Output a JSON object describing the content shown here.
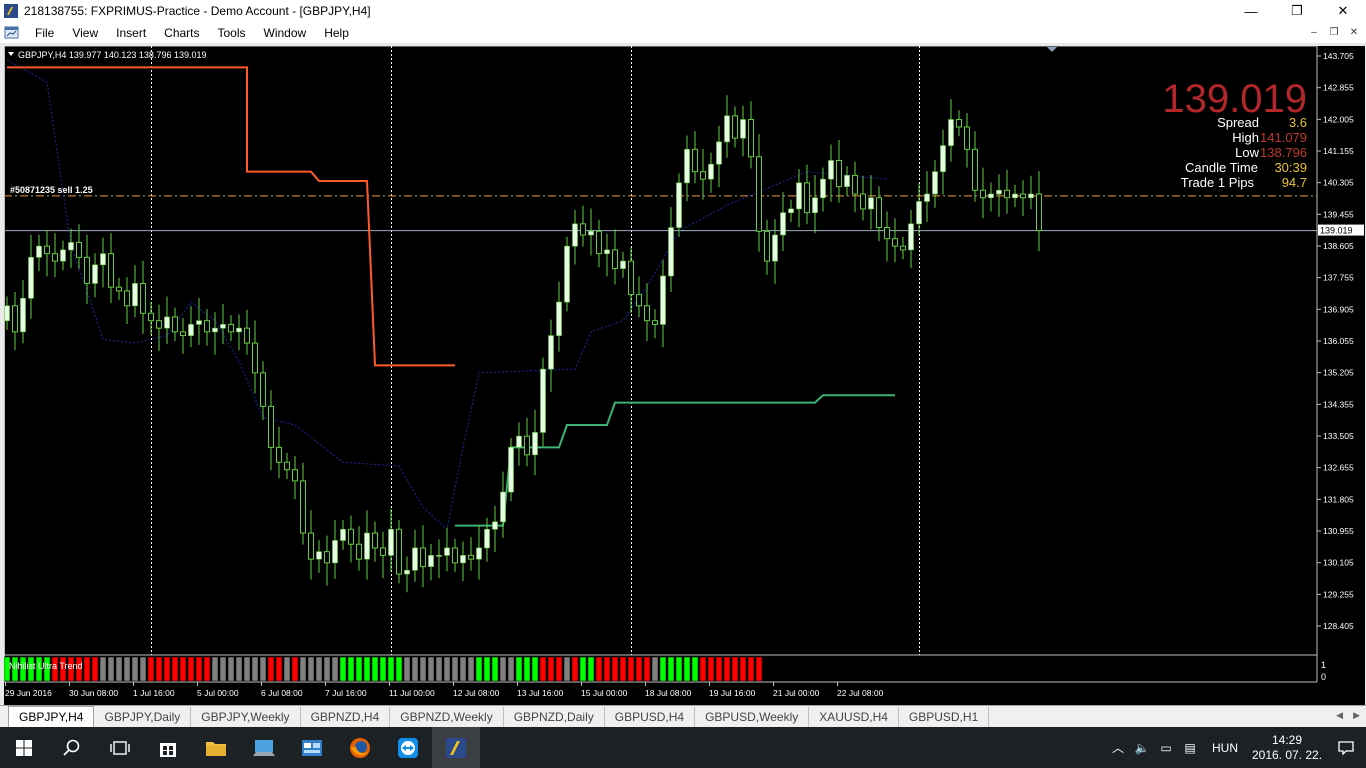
{
  "window": {
    "title": "218138755: FXPRIMUS-Practice - Demo Account - [GBPJPY,H4]",
    "minimize": "—",
    "maximize": "❐",
    "close": "✕"
  },
  "menu": {
    "items": [
      "File",
      "View",
      "Insert",
      "Charts",
      "Tools",
      "Window",
      "Help"
    ]
  },
  "chart": {
    "header": "GBPJPY,H4  139.977 140.123 138.796 139.019",
    "order_label": "#50871235 sell 1.25",
    "current_price_tag": "139.019",
    "info_panel": {
      "price": "139.019",
      "rows": [
        {
          "label": "Spread",
          "value": "3.6"
        },
        {
          "label": "High",
          "value": "141.079"
        },
        {
          "label": "Low",
          "value": "138.796"
        },
        {
          "label": "Candle Time",
          "value": "30:39"
        },
        {
          "label": "Trade 1 Pips",
          "value": "94.7"
        }
      ]
    },
    "indicator_label": "Nihilist Ultra Trend",
    "indicator_scale": [
      "1",
      "0"
    ],
    "colors": {
      "background": "#000000",
      "bull_candle": "#e8ffe8",
      "wick": "#66cc44",
      "upper_line": "#ff5a2a",
      "lower_line": "#3cb371",
      "dotted_line": "#1a2aa0",
      "order_line": "#e89a3c",
      "price_big": "#b3262a",
      "spread_value": "#e8c032",
      "high_value": "#c0392b",
      "low_value": "#c0392b",
      "candle_time_value": "#e8c032",
      "pips_value": "#e8c032",
      "ind_green": "#00ff00",
      "ind_red": "#ff0000",
      "ind_gray": "#808080"
    }
  },
  "chart_data": {
    "type": "candlestick",
    "symbol": "GBPJPY",
    "timeframe": "H4",
    "ylim": [
      128.405,
      143.705
    ],
    "y_ticks": [
      "143.705",
      "142.855",
      "142.005",
      "141.155",
      "140.305",
      "139.455",
      "138.605",
      "137.755",
      "136.905",
      "136.055",
      "135.205",
      "134.355",
      "133.505",
      "132.655",
      "131.805",
      "130.955",
      "130.105",
      "129.255",
      "128.405"
    ],
    "x_ticks": [
      "29 Jun 2016",
      "30 Jun 08:00",
      "1 Jul 16:00",
      "5 Jul 00:00",
      "6 Jul 08:00",
      "7 Jul 16:00",
      "11 Jul 00:00",
      "12 Jul 08:00",
      "13 Jul 16:00",
      "15 Jul 00:00",
      "18 Jul 08:00",
      "19 Jul 16:00",
      "21 Jul 00:00",
      "22 Jul 08:00"
    ],
    "order_price": 139.95,
    "current_price": 139.019,
    "closes": [
      137.0,
      136.3,
      137.2,
      138.3,
      138.6,
      138.4,
      138.2,
      138.5,
      138.7,
      138.3,
      137.6,
      138.1,
      138.4,
      137.5,
      137.4,
      137.0,
      137.6,
      136.8,
      136.6,
      136.4,
      136.7,
      136.3,
      136.2,
      136.5,
      136.6,
      136.3,
      136.4,
      136.5,
      136.3,
      136.4,
      136.0,
      135.2,
      134.3,
      133.2,
      132.8,
      132.6,
      132.3,
      130.9,
      130.2,
      130.4,
      130.1,
      130.7,
      131.0,
      130.6,
      130.2,
      130.9,
      130.5,
      130.3,
      131.0,
      129.8,
      129.9,
      130.5,
      130.0,
      130.3,
      130.3,
      130.5,
      130.1,
      130.3,
      130.2,
      130.5,
      131.0,
      131.2,
      132.0,
      133.2,
      133.5,
      133.0,
      133.6,
      135.3,
      136.2,
      137.1,
      138.6,
      139.2,
      138.9,
      139.0,
      138.4,
      138.5,
      138.0,
      138.2,
      137.3,
      137.0,
      136.6,
      136.5,
      137.8,
      139.1,
      140.3,
      141.2,
      140.6,
      140.4,
      140.8,
      141.4,
      142.1,
      141.5,
      142.0,
      141.0,
      139.0,
      138.2,
      138.9,
      139.5,
      139.6,
      140.3,
      139.5,
      139.9,
      140.4,
      140.9,
      140.2,
      140.5,
      140.0,
      139.6,
      139.9,
      139.1,
      138.8,
      138.6,
      138.5,
      139.2,
      139.8,
      140.0,
      140.6,
      141.3,
      142.0,
      141.8,
      141.2,
      140.1,
      139.9,
      140.0,
      140.1,
      139.9,
      140.0,
      139.9,
      140.0,
      139.019
    ],
    "upper_band": [
      {
        "x": 0,
        "y": 143.4
      },
      {
        "x": 30,
        "y": 143.4
      },
      {
        "x": 30,
        "y": 140.6
      },
      {
        "x": 38,
        "y": 140.6
      },
      {
        "x": 39,
        "y": 140.35
      },
      {
        "x": 45,
        "y": 140.35
      },
      {
        "x": 46,
        "y": 135.4
      },
      {
        "x": 56,
        "y": 135.4
      }
    ],
    "lower_band": [
      {
        "x": 56,
        "y": 131.1
      },
      {
        "x": 62,
        "y": 131.1
      },
      {
        "x": 63,
        "y": 133.2
      },
      {
        "x": 69,
        "y": 133.2
      },
      {
        "x": 70,
        "y": 133.8
      },
      {
        "x": 75,
        "y": 133.8
      },
      {
        "x": 76,
        "y": 134.4
      },
      {
        "x": 101,
        "y": 134.4
      },
      {
        "x": 102,
        "y": 134.6
      },
      {
        "x": 111,
        "y": 134.6
      }
    ],
    "dotted_line": [
      {
        "x": 0,
        "y": 143.6
      },
      {
        "x": 5,
        "y": 143.0
      },
      {
        "x": 8,
        "y": 138.6
      },
      {
        "x": 10,
        "y": 137.4
      },
      {
        "x": 12,
        "y": 136.1
      },
      {
        "x": 16,
        "y": 136.0
      },
      {
        "x": 20,
        "y": 136.2
      },
      {
        "x": 23,
        "y": 137.1
      },
      {
        "x": 26,
        "y": 136.6
      },
      {
        "x": 29,
        "y": 135.5
      },
      {
        "x": 32,
        "y": 134.0
      },
      {
        "x": 36,
        "y": 133.8
      },
      {
        "x": 42,
        "y": 132.8
      },
      {
        "x": 49,
        "y": 132.7
      },
      {
        "x": 52,
        "y": 131.6
      },
      {
        "x": 55,
        "y": 131.0
      },
      {
        "x": 57,
        "y": 133.2
      },
      {
        "x": 59,
        "y": 135.2
      },
      {
        "x": 71,
        "y": 135.3
      },
      {
        "x": 73,
        "y": 136.3
      },
      {
        "x": 77,
        "y": 136.6
      },
      {
        "x": 80,
        "y": 137.5
      },
      {
        "x": 84,
        "y": 139.0
      },
      {
        "x": 90,
        "y": 139.7
      },
      {
        "x": 100,
        "y": 140.6
      },
      {
        "x": 110,
        "y": 140.4
      }
    ],
    "indicator": {
      "name": "Nihilist Ultra Trend",
      "segments": [
        {
          "state": "green",
          "count": 6
        },
        {
          "state": "red",
          "count": 6
        },
        {
          "state": "gray",
          "count": 6
        },
        {
          "state": "red",
          "count": 8
        },
        {
          "state": "gray",
          "count": 7
        },
        {
          "state": "red",
          "count": 2
        },
        {
          "state": "gray",
          "count": 1
        },
        {
          "state": "red",
          "count": 1
        },
        {
          "state": "gray",
          "count": 5
        },
        {
          "state": "green",
          "count": 8
        },
        {
          "state": "gray",
          "count": 9
        },
        {
          "state": "green",
          "count": 3
        },
        {
          "state": "gray",
          "count": 2
        },
        {
          "state": "green",
          "count": 3
        },
        {
          "state": "red",
          "count": 3
        },
        {
          "state": "gray",
          "count": 1
        },
        {
          "state": "red",
          "count": 1
        },
        {
          "state": "green",
          "count": 2
        },
        {
          "state": "red",
          "count": 7
        },
        {
          "state": "gray",
          "count": 1
        },
        {
          "state": "green",
          "count": 5
        },
        {
          "state": "red",
          "count": 8
        }
      ]
    }
  },
  "tabs": [
    "GBPJPY,H4",
    "GBPJPY,Daily",
    "GBPJPY,Weekly",
    "GBPNZD,H4",
    "GBPNZD,Weekly",
    "GBPNZD,Daily",
    "GBPUSD,H4",
    "GBPUSD,Weekly",
    "XAUUSD,H4",
    "GBPUSD,H1"
  ],
  "tab_arrows": {
    "left": "◀",
    "right": "▶"
  },
  "taskbar": {
    "language": "HUN",
    "time": "14:29",
    "date": "2016. 07. 22."
  }
}
